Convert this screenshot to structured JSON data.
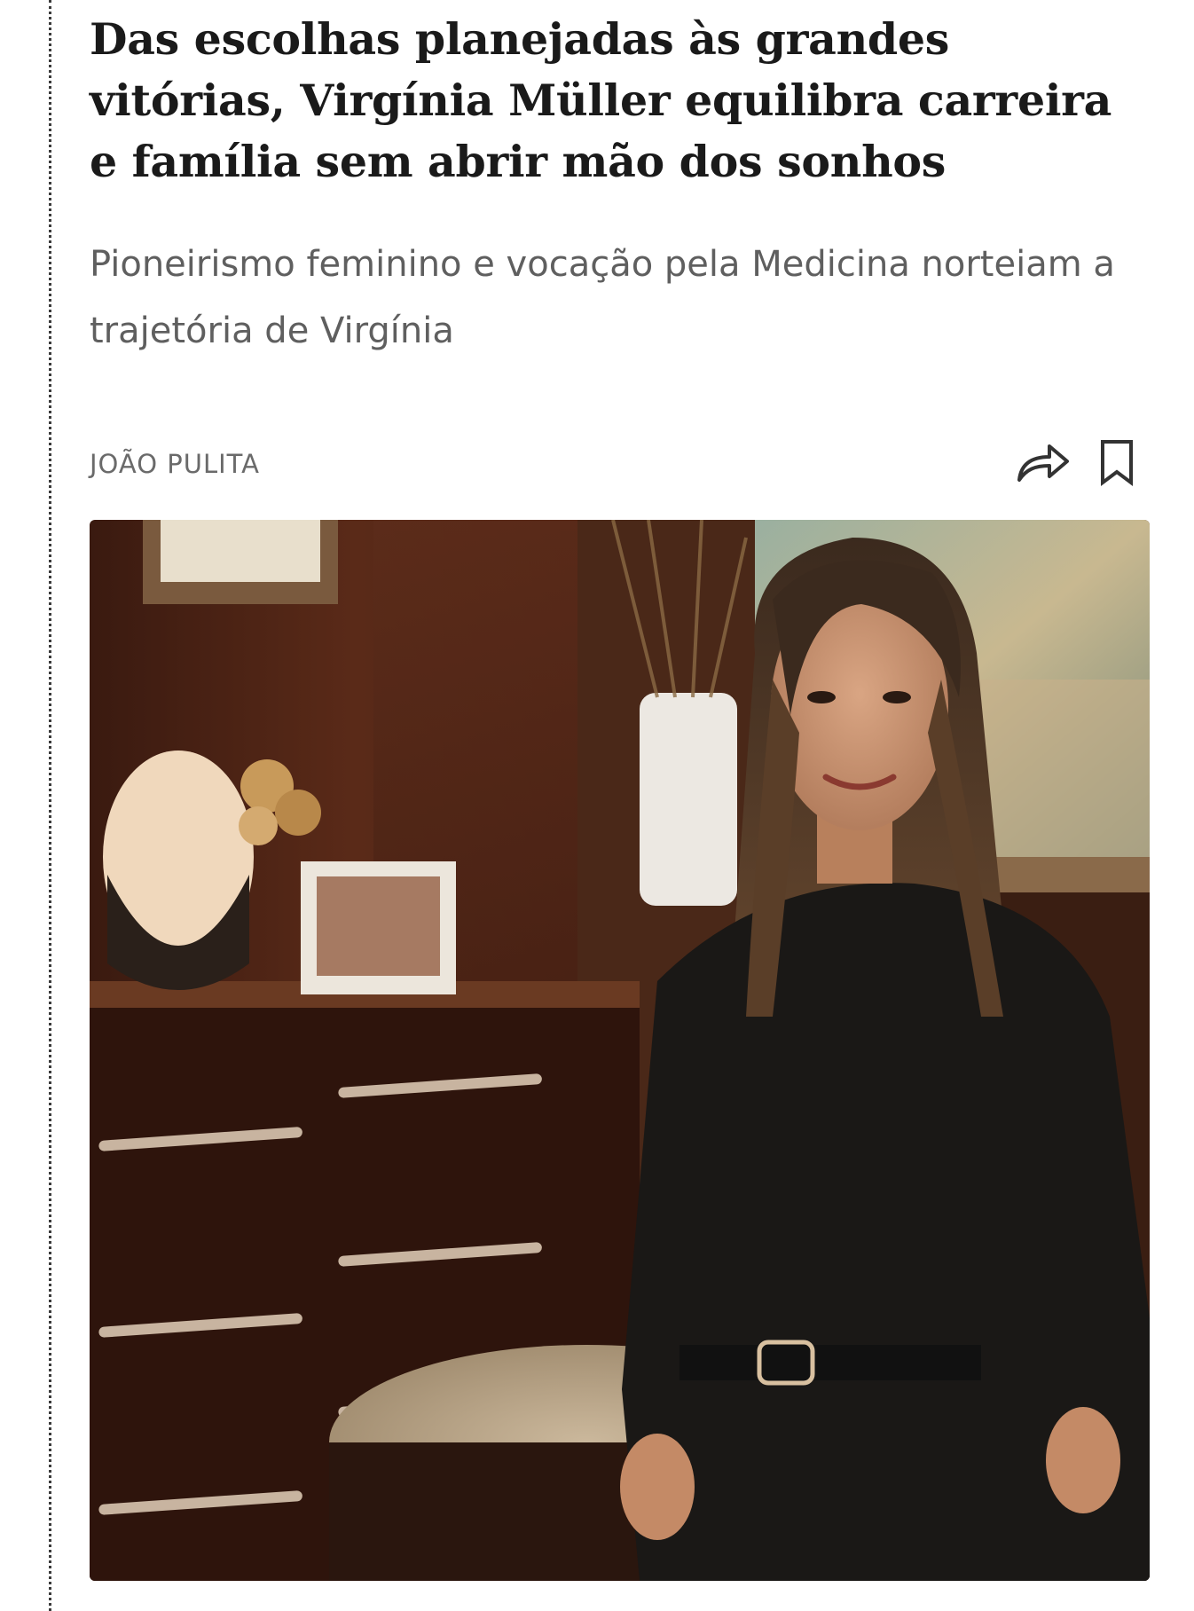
{
  "article": {
    "headline": "Das escolhas planejadas às grandes vitórias, Virgínia Müller equilibra carreira e família sem abrir mão dos sonhos",
    "subtitle": "Pioneirismo feminino e vocação pela Medicina norteiam a trajetória de Virgínia",
    "author": "JOÃO PULITA"
  },
  "actions": {
    "share_icon": "share-arrow-icon",
    "bookmark_icon": "bookmark-icon"
  },
  "photo": {
    "subject": "portrait-woman-office"
  },
  "colors": {
    "headline": "#1a1a1a",
    "subtitle": "#5f5f5f",
    "byline": "#6a6a6a",
    "icon": "#333333"
  }
}
